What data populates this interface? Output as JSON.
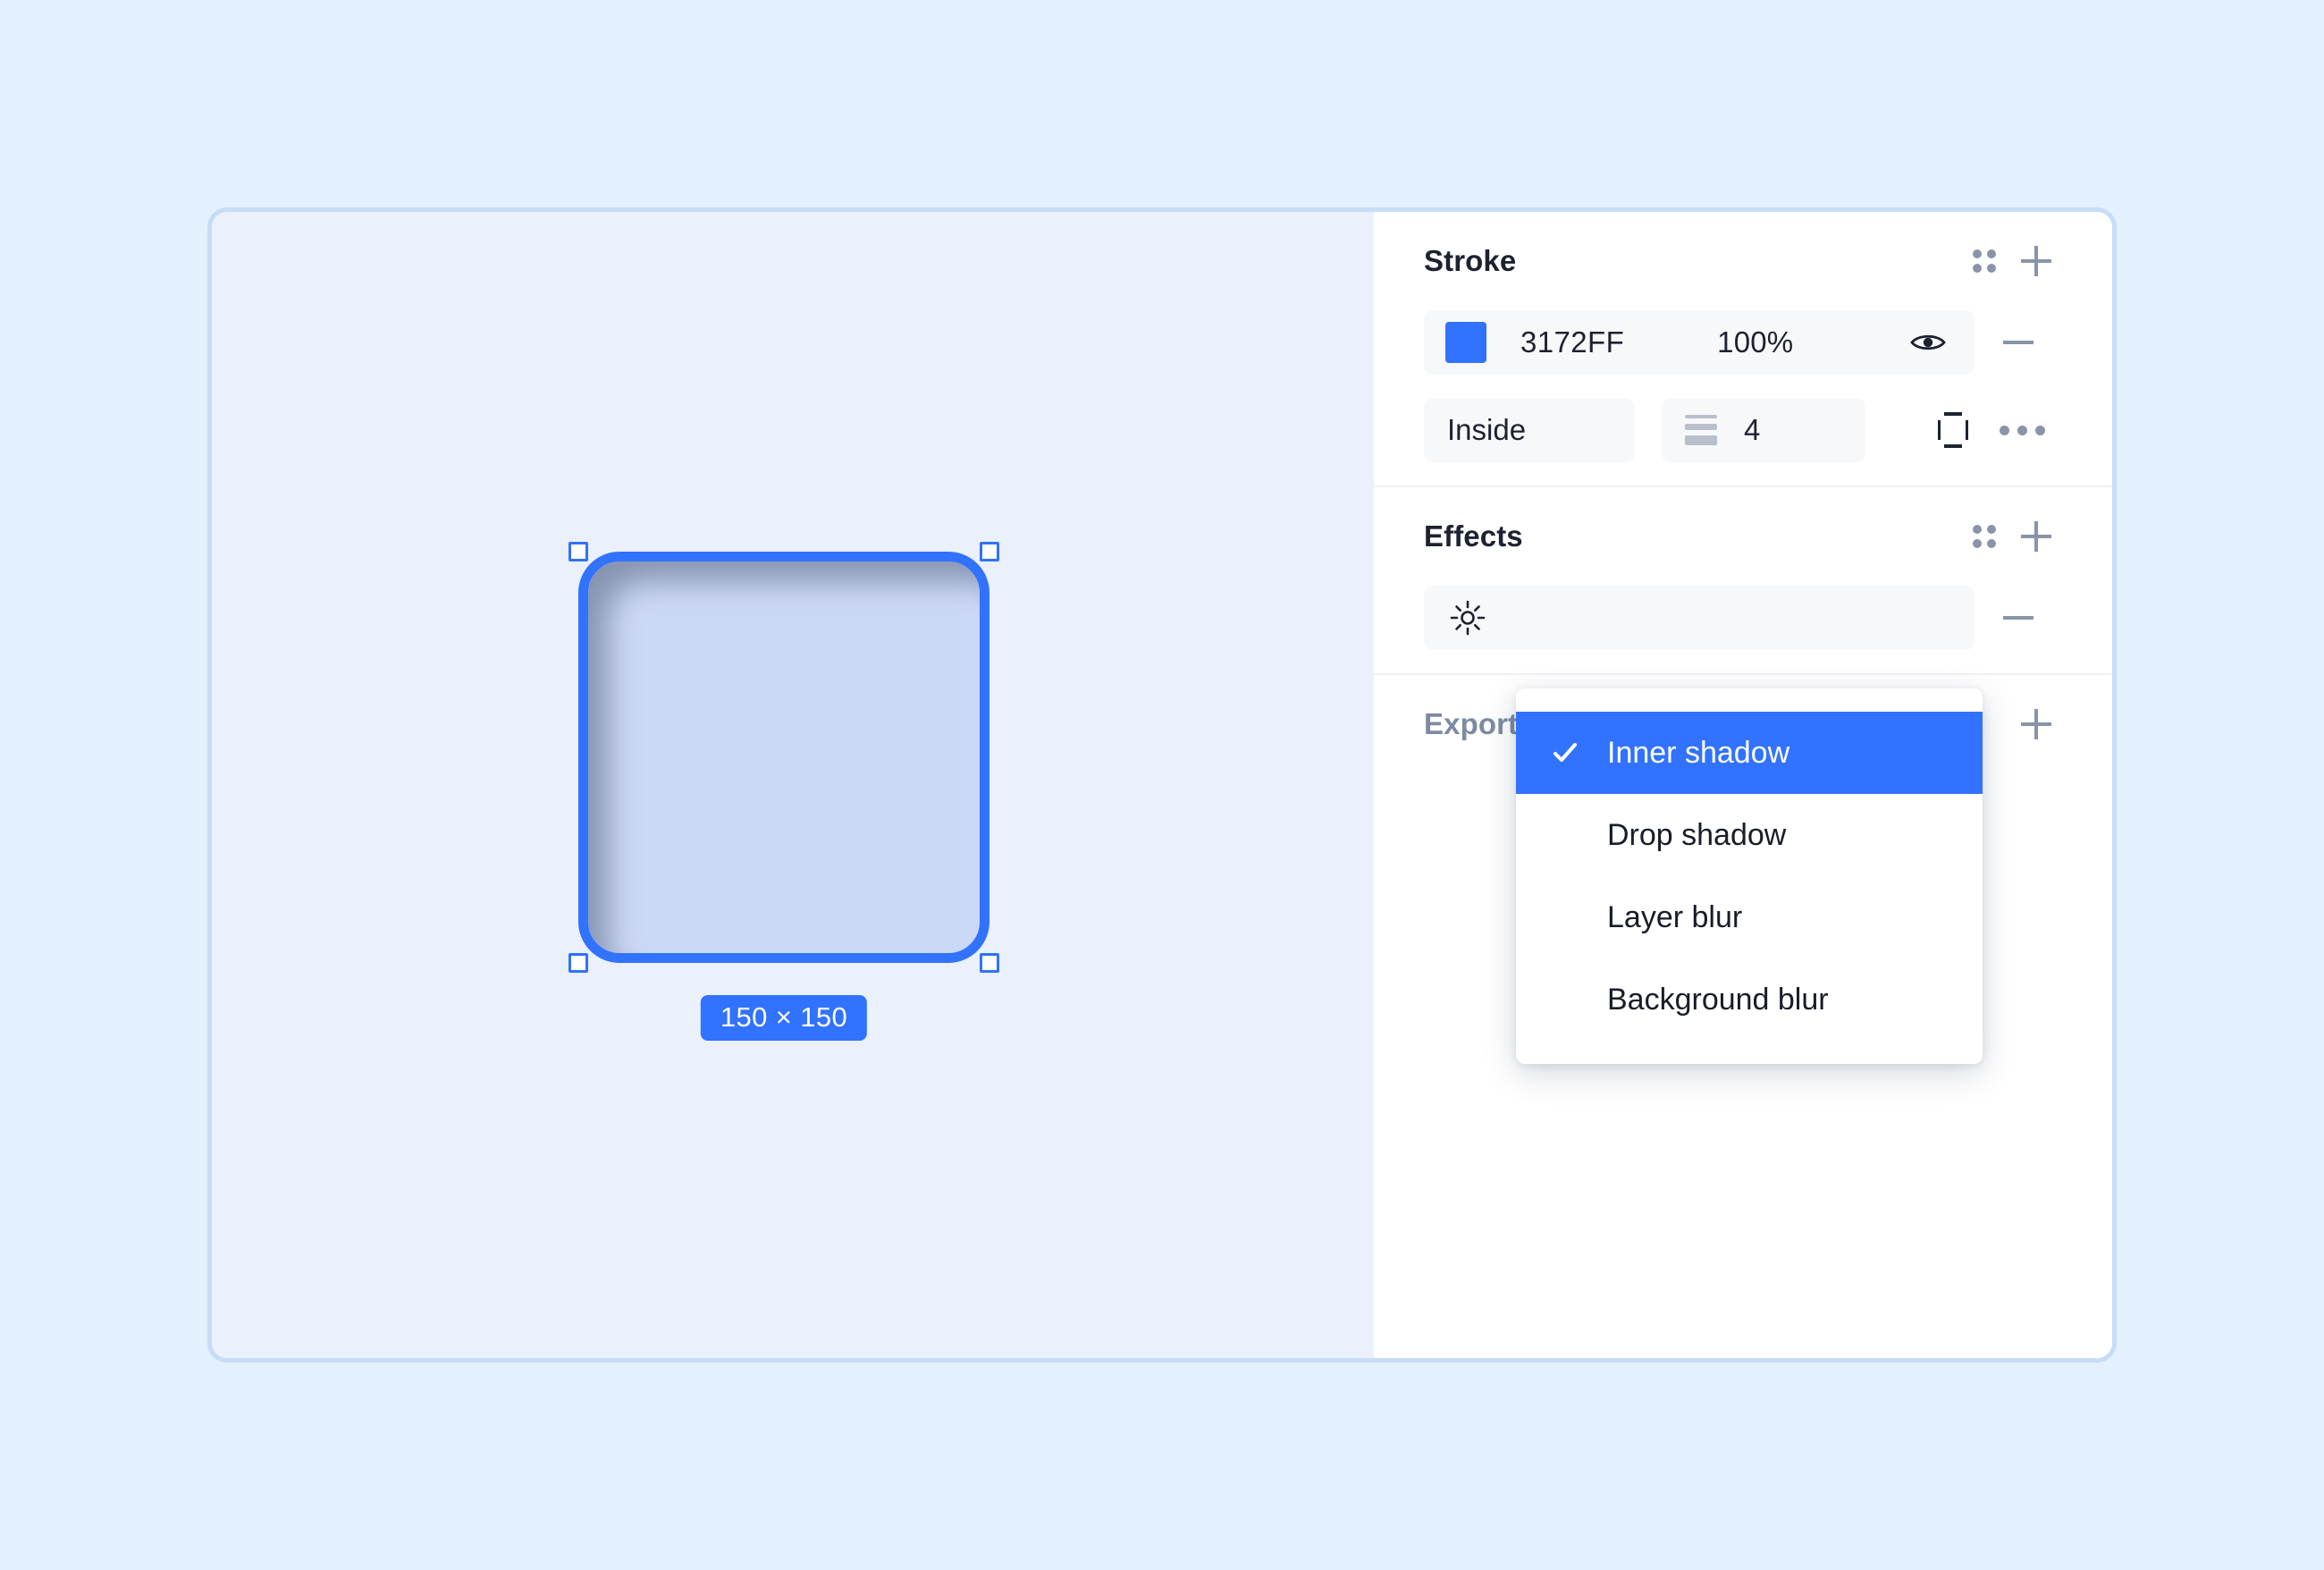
{
  "canvas": {
    "shape": {
      "name": "rounded-rectangle",
      "fill_color": "#ccd9f6",
      "stroke_color": "#3172ff",
      "size_badge": "150 × 150"
    }
  },
  "panel": {
    "sections": [
      {
        "id": "stroke",
        "title": "Stroke",
        "styles_icon": "dot-grid-icon",
        "add_icon": "plus-icon",
        "remove_icon": "minus-icon",
        "color": {
          "swatch_hex": "#3172ff",
          "hex_label": "3172FF",
          "opacity_label": "100%",
          "visibility_icon": "eye-icon"
        },
        "align": {
          "value": "Inside",
          "chevron_icon": "chevron-down-icon"
        },
        "weight": {
          "icon": "stroke-weight-icon",
          "value": "4"
        },
        "sides_icon": "stroke-sides-icon",
        "more_icon": "more-horizontal-icon"
      },
      {
        "id": "effects",
        "title": "Effects",
        "styles_icon": "dot-grid-icon",
        "add_icon": "plus-icon",
        "remove_icon": "minus-icon",
        "effect_icon": "brightness-sun-icon"
      },
      {
        "id": "export",
        "title": "Export",
        "add_icon": "plus-icon"
      }
    ]
  },
  "dropdown": {
    "name": "effect-type-menu",
    "selected": "Inner shadow",
    "check_icon": "check-icon",
    "items": [
      {
        "label": "Inner shadow",
        "selected": true
      },
      {
        "label": "Drop shadow",
        "selected": false
      },
      {
        "label": "Layer blur",
        "selected": false
      },
      {
        "label": "Background blur",
        "selected": false
      }
    ]
  },
  "colors": {
    "page_background": "#e3f0fd",
    "canvas_background": "#eaf0fc",
    "panel_background": "#ffffff",
    "accent": "#3172ff",
    "muted_text": "#7d8ba2"
  }
}
